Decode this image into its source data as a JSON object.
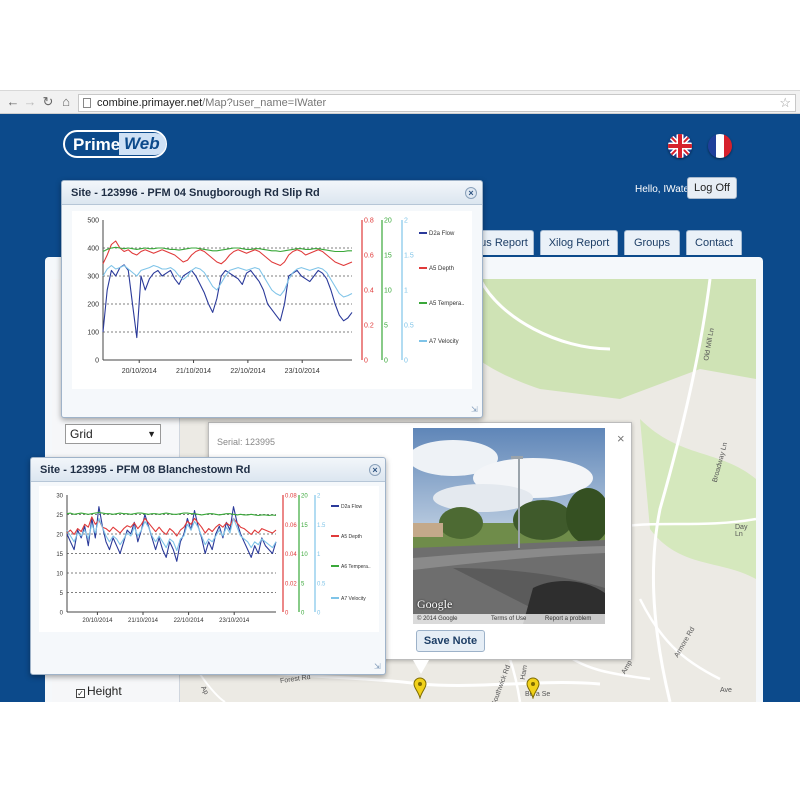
{
  "browser": {
    "url_domain": "combine.primayer.net",
    "url_path": "/Map?user_name=IWater"
  },
  "app": {
    "logo_prime": "Prime",
    "logo_web": "Web",
    "greeting": "Hello, IWater!",
    "logoff_label": "Log Off",
    "tabs": [
      {
        "label": "us Report"
      },
      {
        "label": "Xilog Report"
      },
      {
        "label": "Groups"
      },
      {
        "label": "Contact"
      }
    ],
    "view_select": "Grid",
    "layers": {
      "height_label": "Height",
      "height_checked": true
    }
  },
  "popup": {
    "serial": "Serial: 123995",
    "close": "×",
    "save_note_label": "Save Note",
    "streetview": {
      "google": "Google",
      "copyright": "© 2014 Google",
      "terms": "Terms of Use",
      "report": "Report a problem"
    }
  },
  "map_labels": {
    "old_mill": "Old Mill Ln",
    "broadway": "Broadway Ln",
    "day": "Day Ln",
    "forest": "Forest Rd",
    "southwick": "Southwick Rd",
    "armore": "Armore Rd",
    "hamble": "Ham",
    "bera": "Bera Se",
    "aveln": "Ave",
    "amp": "Amp",
    "ap": "Ap"
  },
  "windows": [
    {
      "title": "Site - 123996 - PFM 04 Snugborough Rd Slip Rd",
      "close": "×"
    },
    {
      "title": "Site - 123995 - PFM 08 Blanchestown Rd",
      "close": "×"
    }
  ],
  "chart_data": [
    {
      "type": "line",
      "x_ticks": [
        "20/10/2014",
        "21/10/2014",
        "22/10/2014",
        "23/10/2014"
      ],
      "x_range": [
        "2014-10-19T08:00",
        "2014-10-23T22:00"
      ],
      "axes": [
        {
          "side": "left",
          "ticks": [
            "500",
            "400",
            "300",
            "200",
            "100",
            "0"
          ],
          "range": [
            0,
            500
          ],
          "color": "#444444"
        },
        {
          "side": "right",
          "ticks": [
            "0.8",
            "0.6",
            "0.4",
            "0.2",
            "0"
          ],
          "range": [
            0,
            0.8
          ],
          "color": "#e03a3a"
        },
        {
          "side": "right",
          "ticks": [
            "20",
            "15",
            "10",
            "5",
            "0"
          ],
          "range": [
            0,
            20
          ],
          "color": "#3aa83a"
        },
        {
          "side": "right",
          "ticks": [
            "2",
            "1.5",
            "1",
            "0.5",
            "0"
          ],
          "range": [
            0,
            2
          ],
          "color": "#7fc4e8"
        }
      ],
      "grid_values": [
        400,
        300,
        200,
        100
      ],
      "series": [
        {
          "name": "D2a Flow",
          "color": "#2b3a9a",
          "axis": 0,
          "y": [
            100,
            250,
            320,
            300,
            330,
            340,
            320,
            200,
            80,
            300,
            250,
            290,
            310,
            320,
            300,
            310,
            320,
            290,
            270,
            300,
            310,
            320,
            300,
            270,
            240,
            200,
            170,
            220,
            300,
            320,
            310,
            300,
            290,
            270,
            310,
            320,
            300,
            280,
            250,
            200,
            180,
            160,
            140,
            200,
            300,
            310,
            320,
            300,
            290,
            280,
            300,
            320,
            310,
            290,
            250,
            200,
            160,
            140,
            150,
            170
          ]
        },
        {
          "name": "A5 Depth",
          "color": "#e03a3a",
          "axis": 1,
          "y": [
            0.55,
            0.6,
            0.66,
            0.68,
            0.64,
            0.62,
            0.63,
            0.61,
            0.6,
            0.62,
            0.63,
            0.62,
            0.61,
            0.62,
            0.63,
            0.62,
            0.61,
            0.6,
            0.58,
            0.56,
            0.57,
            0.6,
            0.62,
            0.63,
            0.62,
            0.6,
            0.58,
            0.56,
            0.55,
            0.57,
            0.6,
            0.62,
            0.63,
            0.62,
            0.61,
            0.62,
            0.63,
            0.62,
            0.6,
            0.58,
            0.56,
            0.55,
            0.54,
            0.56,
            0.6,
            0.62,
            0.63,
            0.62,
            0.6,
            0.61,
            0.62,
            0.63,
            0.62,
            0.6,
            0.58,
            0.56,
            0.55,
            0.54,
            0.55,
            0.56
          ]
        },
        {
          "name": "A5 Tempera..",
          "color": "#3aa83a",
          "axis": 2,
          "y": [
            15.5,
            15.8,
            16.0,
            16.1,
            16.0,
            15.9,
            16.0,
            15.9,
            15.8,
            15.9,
            16.0,
            15.9,
            15.9,
            16.0,
            16.0,
            15.9,
            15.8,
            15.8,
            15.7,
            15.8,
            15.9,
            16.0,
            16.0,
            15.9,
            15.8,
            15.7,
            15.6,
            15.6,
            15.7,
            15.8,
            15.9,
            16.0,
            16.0,
            15.9,
            15.8,
            15.8,
            15.9,
            15.9,
            15.8,
            15.7,
            15.6,
            15.6,
            15.5,
            15.6,
            15.7,
            15.8,
            15.9,
            15.9,
            15.8,
            15.8,
            15.9,
            15.9,
            15.8,
            15.7,
            15.6,
            15.5,
            15.5,
            15.5,
            15.6,
            15.6
          ]
        },
        {
          "name": "A7 Velocity",
          "color": "#7fc4e8",
          "axis": 3,
          "y": [
            1.2,
            1.3,
            1.35,
            1.3,
            1.32,
            1.35,
            1.3,
            1.25,
            1.2,
            1.28,
            1.3,
            1.32,
            1.35,
            1.33,
            1.3,
            1.3,
            1.32,
            1.28,
            1.2,
            1.15,
            1.2,
            1.28,
            1.32,
            1.3,
            1.25,
            1.15,
            1.05,
            1.0,
            1.1,
            1.2,
            1.28,
            1.3,
            1.32,
            1.3,
            1.28,
            1.3,
            1.32,
            1.3,
            1.2,
            1.1,
            1.0,
            0.95,
            0.92,
            1.0,
            1.15,
            1.25,
            1.3,
            1.32,
            1.3,
            1.28,
            1.3,
            1.32,
            1.3,
            1.25,
            1.15,
            1.05,
            0.95,
            0.9,
            0.92,
            0.95
          ]
        }
      ]
    },
    {
      "type": "line",
      "x_ticks": [
        "20/10/2014",
        "21/10/2014",
        "22/10/2014",
        "23/10/2014"
      ],
      "x_range": [
        "2014-10-19T08:00",
        "2014-10-23T22:00"
      ],
      "axes": [
        {
          "side": "left",
          "ticks": [
            "30",
            "25",
            "20",
            "15",
            "10",
            "5",
            "0"
          ],
          "range": [
            0,
            30
          ],
          "color": "#444444"
        },
        {
          "side": "right",
          "ticks": [
            "0.08",
            "0.06",
            "0.04",
            "0.02",
            "0"
          ],
          "range": [
            0,
            0.08
          ],
          "color": "#e03a3a"
        },
        {
          "side": "right",
          "ticks": [
            "20",
            "15",
            "10",
            "5",
            "0"
          ],
          "range": [
            0,
            20
          ],
          "color": "#3aa83a"
        },
        {
          "side": "right",
          "ticks": [
            "2",
            "1.5",
            "1",
            "0.5",
            "0"
          ],
          "range": [
            0,
            2
          ],
          "color": "#7fc4e8"
        }
      ],
      "grid_values": [
        25,
        20,
        15,
        10,
        5
      ],
      "series": [
        {
          "name": "D2a Flow",
          "color": "#2b3a9a",
          "axis": 0,
          "y": [
            20,
            18,
            16,
            21,
            19,
            22,
            17,
            24,
            19,
            27,
            22,
            18,
            16,
            19,
            17,
            15,
            18,
            21,
            20,
            23,
            18,
            21,
            25,
            22,
            19,
            16,
            19,
            16,
            14,
            18,
            16,
            13,
            18,
            20,
            24,
            21,
            26,
            22,
            19,
            15,
            18,
            16,
            20,
            22,
            19,
            23,
            21,
            27,
            23,
            20,
            18,
            16,
            14,
            17,
            15,
            19,
            17,
            16,
            15,
            18
          ]
        },
        {
          "name": "A5 Depth",
          "color": "#e03a3a",
          "axis": 1,
          "y": [
            0.054,
            0.056,
            0.053,
            0.057,
            0.055,
            0.06,
            0.058,
            0.065,
            0.06,
            0.063,
            0.058,
            0.057,
            0.055,
            0.058,
            0.056,
            0.054,
            0.057,
            0.059,
            0.058,
            0.061,
            0.057,
            0.06,
            0.064,
            0.061,
            0.058,
            0.055,
            0.058,
            0.055,
            0.053,
            0.057,
            0.055,
            0.052,
            0.056,
            0.058,
            0.062,
            0.06,
            0.064,
            0.061,
            0.058,
            0.054,
            0.057,
            0.055,
            0.058,
            0.06,
            0.058,
            0.061,
            0.059,
            0.064,
            0.061,
            0.058,
            0.057,
            0.055,
            0.053,
            0.056,
            0.054,
            0.057,
            0.056,
            0.055,
            0.054,
            0.056
          ]
        },
        {
          "name": "A6 Tempera..",
          "color": "#3aa83a",
          "axis": 2,
          "y": [
            16.8,
            16.9,
            16.7,
            16.8,
            16.9,
            16.8,
            16.7,
            16.8,
            16.9,
            17.0,
            16.9,
            16.8,
            16.8,
            16.7,
            16.8,
            16.9,
            16.8,
            16.8,
            16.7,
            16.8,
            16.9,
            16.9,
            16.8,
            16.7,
            16.8,
            16.8,
            16.7,
            16.8,
            16.9,
            16.8,
            16.7,
            16.7,
            16.8,
            16.9,
            16.9,
            16.8,
            16.8,
            16.7,
            16.6,
            16.7,
            16.8,
            16.8,
            16.7,
            16.6,
            16.7,
            16.8,
            16.8,
            16.7,
            16.6,
            16.7,
            16.6,
            16.6,
            16.7,
            16.6,
            16.5,
            16.6,
            16.6,
            16.5,
            16.6,
            16.5
          ]
        },
        {
          "name": "A7 Velocity",
          "color": "#7fc4e8",
          "axis": 3,
          "y": [
            1.4,
            1.3,
            1.2,
            1.35,
            1.3,
            1.4,
            1.25,
            1.5,
            1.35,
            1.6,
            1.45,
            1.3,
            1.2,
            1.3,
            1.25,
            1.15,
            1.25,
            1.35,
            1.3,
            1.45,
            1.3,
            1.4,
            1.55,
            1.45,
            1.3,
            1.2,
            1.3,
            1.2,
            1.1,
            1.25,
            1.2,
            1.05,
            1.25,
            1.3,
            1.5,
            1.4,
            1.55,
            1.45,
            1.3,
            1.15,
            1.25,
            1.2,
            1.3,
            1.4,
            1.3,
            1.45,
            1.35,
            1.6,
            1.45,
            1.3,
            1.25,
            1.2,
            1.1,
            1.2,
            1.15,
            1.25,
            1.2,
            1.15,
            1.1,
            1.2
          ]
        }
      ]
    }
  ]
}
